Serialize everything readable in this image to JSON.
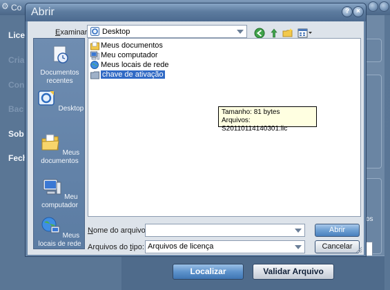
{
  "background_app": {
    "title": "Co",
    "nav_items": [
      {
        "label": "Lice",
        "dim": false
      },
      {
        "label": "Cria",
        "dim": true
      },
      {
        "label": "Con",
        "dim": true
      },
      {
        "label": "Bac",
        "dim": true
      },
      {
        "label": "Sob",
        "dim": false
      },
      {
        "label": "Fech",
        "dim": false
      }
    ],
    "side_text": "os",
    "buttons": {
      "locate": "Localizar",
      "validate": "Validar Arquivo"
    }
  },
  "dialog": {
    "title": "Abrir",
    "controls": {
      "help": "?",
      "close": "×"
    },
    "look_in": {
      "label_prefix": "",
      "label_accel": "E",
      "label_rest": "xaminar:",
      "value": "Desktop"
    },
    "toolbar": [
      "back-icon",
      "up-folder-icon",
      "new-folder-icon",
      "view-menu-icon"
    ],
    "places": [
      {
        "label": "Documentos recentes",
        "icon": "recent-documents-icon"
      },
      {
        "label": "Desktop",
        "icon": "desktop-icon"
      },
      {
        "label": "Meus documentos",
        "icon": "my-documents-icon"
      },
      {
        "label": "Meu computador",
        "icon": "my-computer-icon"
      },
      {
        "label": "Meus locais de rede",
        "icon": "network-places-icon"
      }
    ],
    "files": [
      {
        "name": "Meus documentos",
        "icon": "my-documents-icon",
        "selected": false
      },
      {
        "name": "Meu computador",
        "icon": "my-computer-icon",
        "selected": false
      },
      {
        "name": "Meus locais de rede",
        "icon": "network-places-icon",
        "selected": false
      },
      {
        "name": "chave de ativação",
        "icon": "folder-icon",
        "selected": true
      }
    ],
    "tooltip": {
      "line1": "Tamanho: 81 bytes",
      "line2": "Arquivos: S20110114140301.lic"
    },
    "filename": {
      "label_prefix": "",
      "label_accel": "N",
      "label_rest": "ome do arquivo:",
      "value": ""
    },
    "filetype": {
      "label_prefix": "Arquivos do ",
      "label_accel": "t",
      "label_rest": "ipo:",
      "value": "Arquivos de licença"
    },
    "buttons": {
      "open": "Abrir",
      "cancel": "Cancelar"
    }
  },
  "colors": {
    "selection": "#316ac5",
    "tooltip_bg": "#ffffe1",
    "dialog_frame": "#6a87a8",
    "primary_button": "#6d9fd2"
  }
}
